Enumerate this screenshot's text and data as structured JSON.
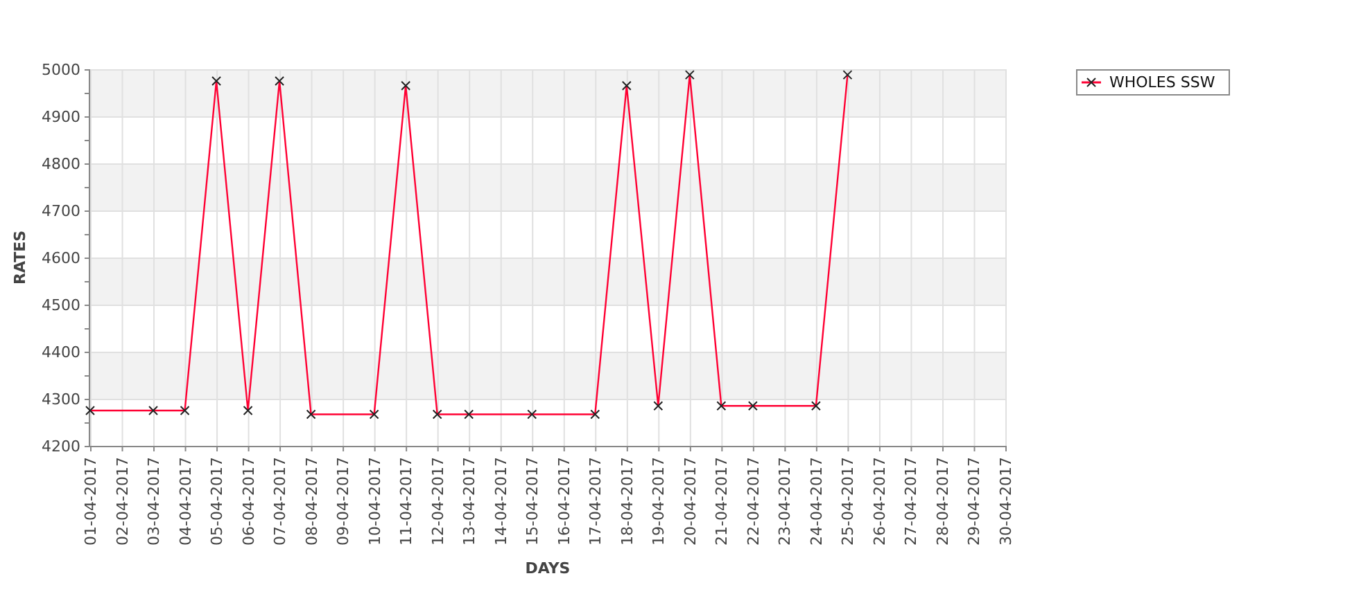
{
  "chart": {
    "chart_data": {
      "type": "line",
      "xlabel": "DAYS",
      "ylabel": "RATES",
      "categories": [
        "01-04-2017",
        "02-04-2017",
        "03-04-2017",
        "04-04-2017",
        "05-04-2017",
        "06-04-2017",
        "07-04-2017",
        "08-04-2017",
        "09-04-2017",
        "10-04-2017",
        "11-04-2017",
        "12-04-2017",
        "13-04-2017",
        "14-04-2017",
        "15-04-2017",
        "16-04-2017",
        "17-04-2017",
        "18-04-2017",
        "19-04-2017",
        "20-04-2017",
        "21-04-2017",
        "22-04-2017",
        "23-04-2017",
        "24-04-2017",
        "25-04-2017",
        "26-04-2017",
        "27-04-2017",
        "28-04-2017",
        "29-04-2017",
        "30-04-2017"
      ],
      "grid": true,
      "series": [
        {
          "name": "WHOLES SSW",
          "color": "#ff0033",
          "marker": "x",
          "values": [
            4275,
            null,
            4275,
            4275,
            4975,
            4275,
            4975,
            4267,
            null,
            4267,
            4965,
            4267,
            4267,
            null,
            4267,
            null,
            4267,
            4965,
            4285,
            4988,
            4285,
            4285,
            null,
            4285,
            4988,
            null,
            null,
            null,
            null,
            null
          ]
        }
      ],
      "ylim": [
        4200,
        5000
      ],
      "yticks": [
        4200,
        4300,
        4400,
        4500,
        4600,
        4700,
        4800,
        4900,
        5000
      ]
    }
  }
}
